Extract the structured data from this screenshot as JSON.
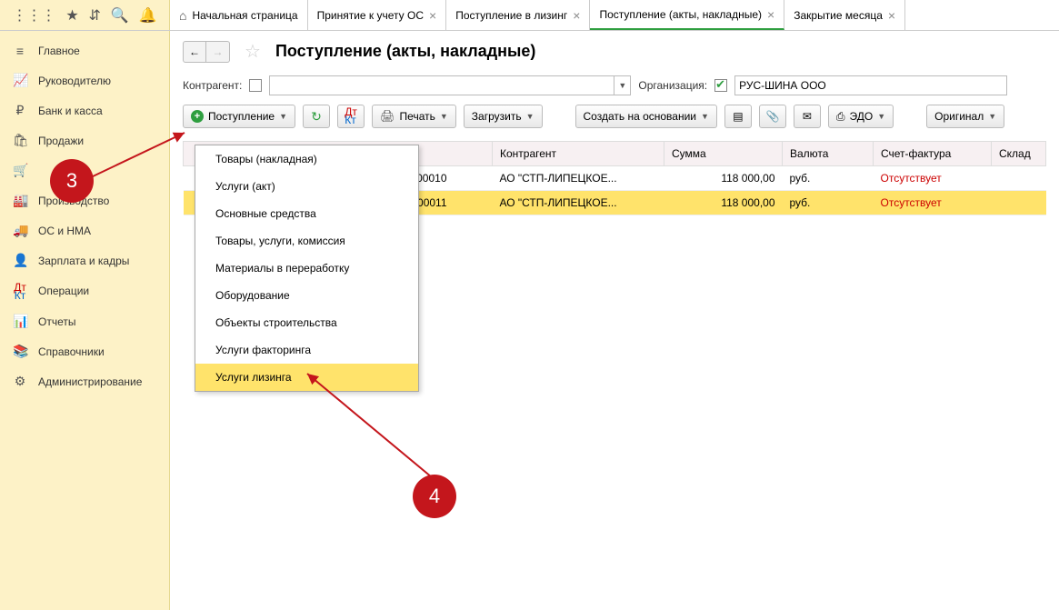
{
  "topIcons": [
    "grid",
    "star",
    "arrows",
    "search",
    "bell"
  ],
  "tabs": [
    {
      "label": "Начальная страница",
      "home": true,
      "close": false
    },
    {
      "label": "Принятие к учету ОС",
      "close": true
    },
    {
      "label": "Поступление в лизинг",
      "close": true
    },
    {
      "label": "Поступление (акты, накладные)",
      "close": true,
      "active": true
    },
    {
      "label": "Закрытие месяца",
      "close": true
    }
  ],
  "sidebar": [
    {
      "icon": "≡",
      "label": "Главное"
    },
    {
      "icon": "↗",
      "label": "Руководителю"
    },
    {
      "icon": "₽",
      "label": "Банк и касса"
    },
    {
      "icon": "🛍",
      "label": "Продажи"
    },
    {
      "icon": "🛒",
      "label": ""
    },
    {
      "icon": "🏭",
      "label": "Производство"
    },
    {
      "icon": "🚚",
      "label": "ОС и НМА"
    },
    {
      "icon": "👤",
      "label": "Зарплата и кадры"
    },
    {
      "icon": "Дт",
      "label": "Операции"
    },
    {
      "icon": "📊",
      "label": "Отчеты"
    },
    {
      "icon": "📚",
      "label": "Справочники"
    },
    {
      "icon": "⚙",
      "label": "Администрирование"
    }
  ],
  "title": "Поступление (акты, накладные)",
  "filters": {
    "counterpartyLabel": "Контрагент:",
    "orgLabel": "Организация:",
    "orgValue": "РУС-ШИНА ООО"
  },
  "toolbar": {
    "create": "Поступление",
    "print": "Печать",
    "load": "Загрузить",
    "basedOn": "Создать на основании",
    "edo": "ЭДО",
    "original": "Оригинал"
  },
  "dropdown": [
    "Товары (накладная)",
    "Услуги (акт)",
    "Основные средства",
    "Товары, услуги, комиссия",
    "Материалы в переработку",
    "Оборудование",
    "Объекты строительства",
    "Услуги факторинга",
    "Услуги лизинга"
  ],
  "table": {
    "headers": {
      "h2": "Контрагент",
      "h3": "Сумма",
      "h4": "Валюта",
      "h5": "Счет-фактура",
      "h6": "Склад"
    },
    "rows": [
      {
        "num": "000010",
        "cp": "АО \"СТП-ЛИПЕЦКОЕ...",
        "sum": "118 000,00",
        "cur": "руб.",
        "sf": "Отсутствует"
      },
      {
        "num": "000011",
        "cp": "АО \"СТП-ЛИПЕЦКОЕ...",
        "sum": "118 000,00",
        "cur": "руб.",
        "sf": "Отсутствует"
      }
    ]
  },
  "badges": {
    "b3": "3",
    "b4": "4"
  }
}
